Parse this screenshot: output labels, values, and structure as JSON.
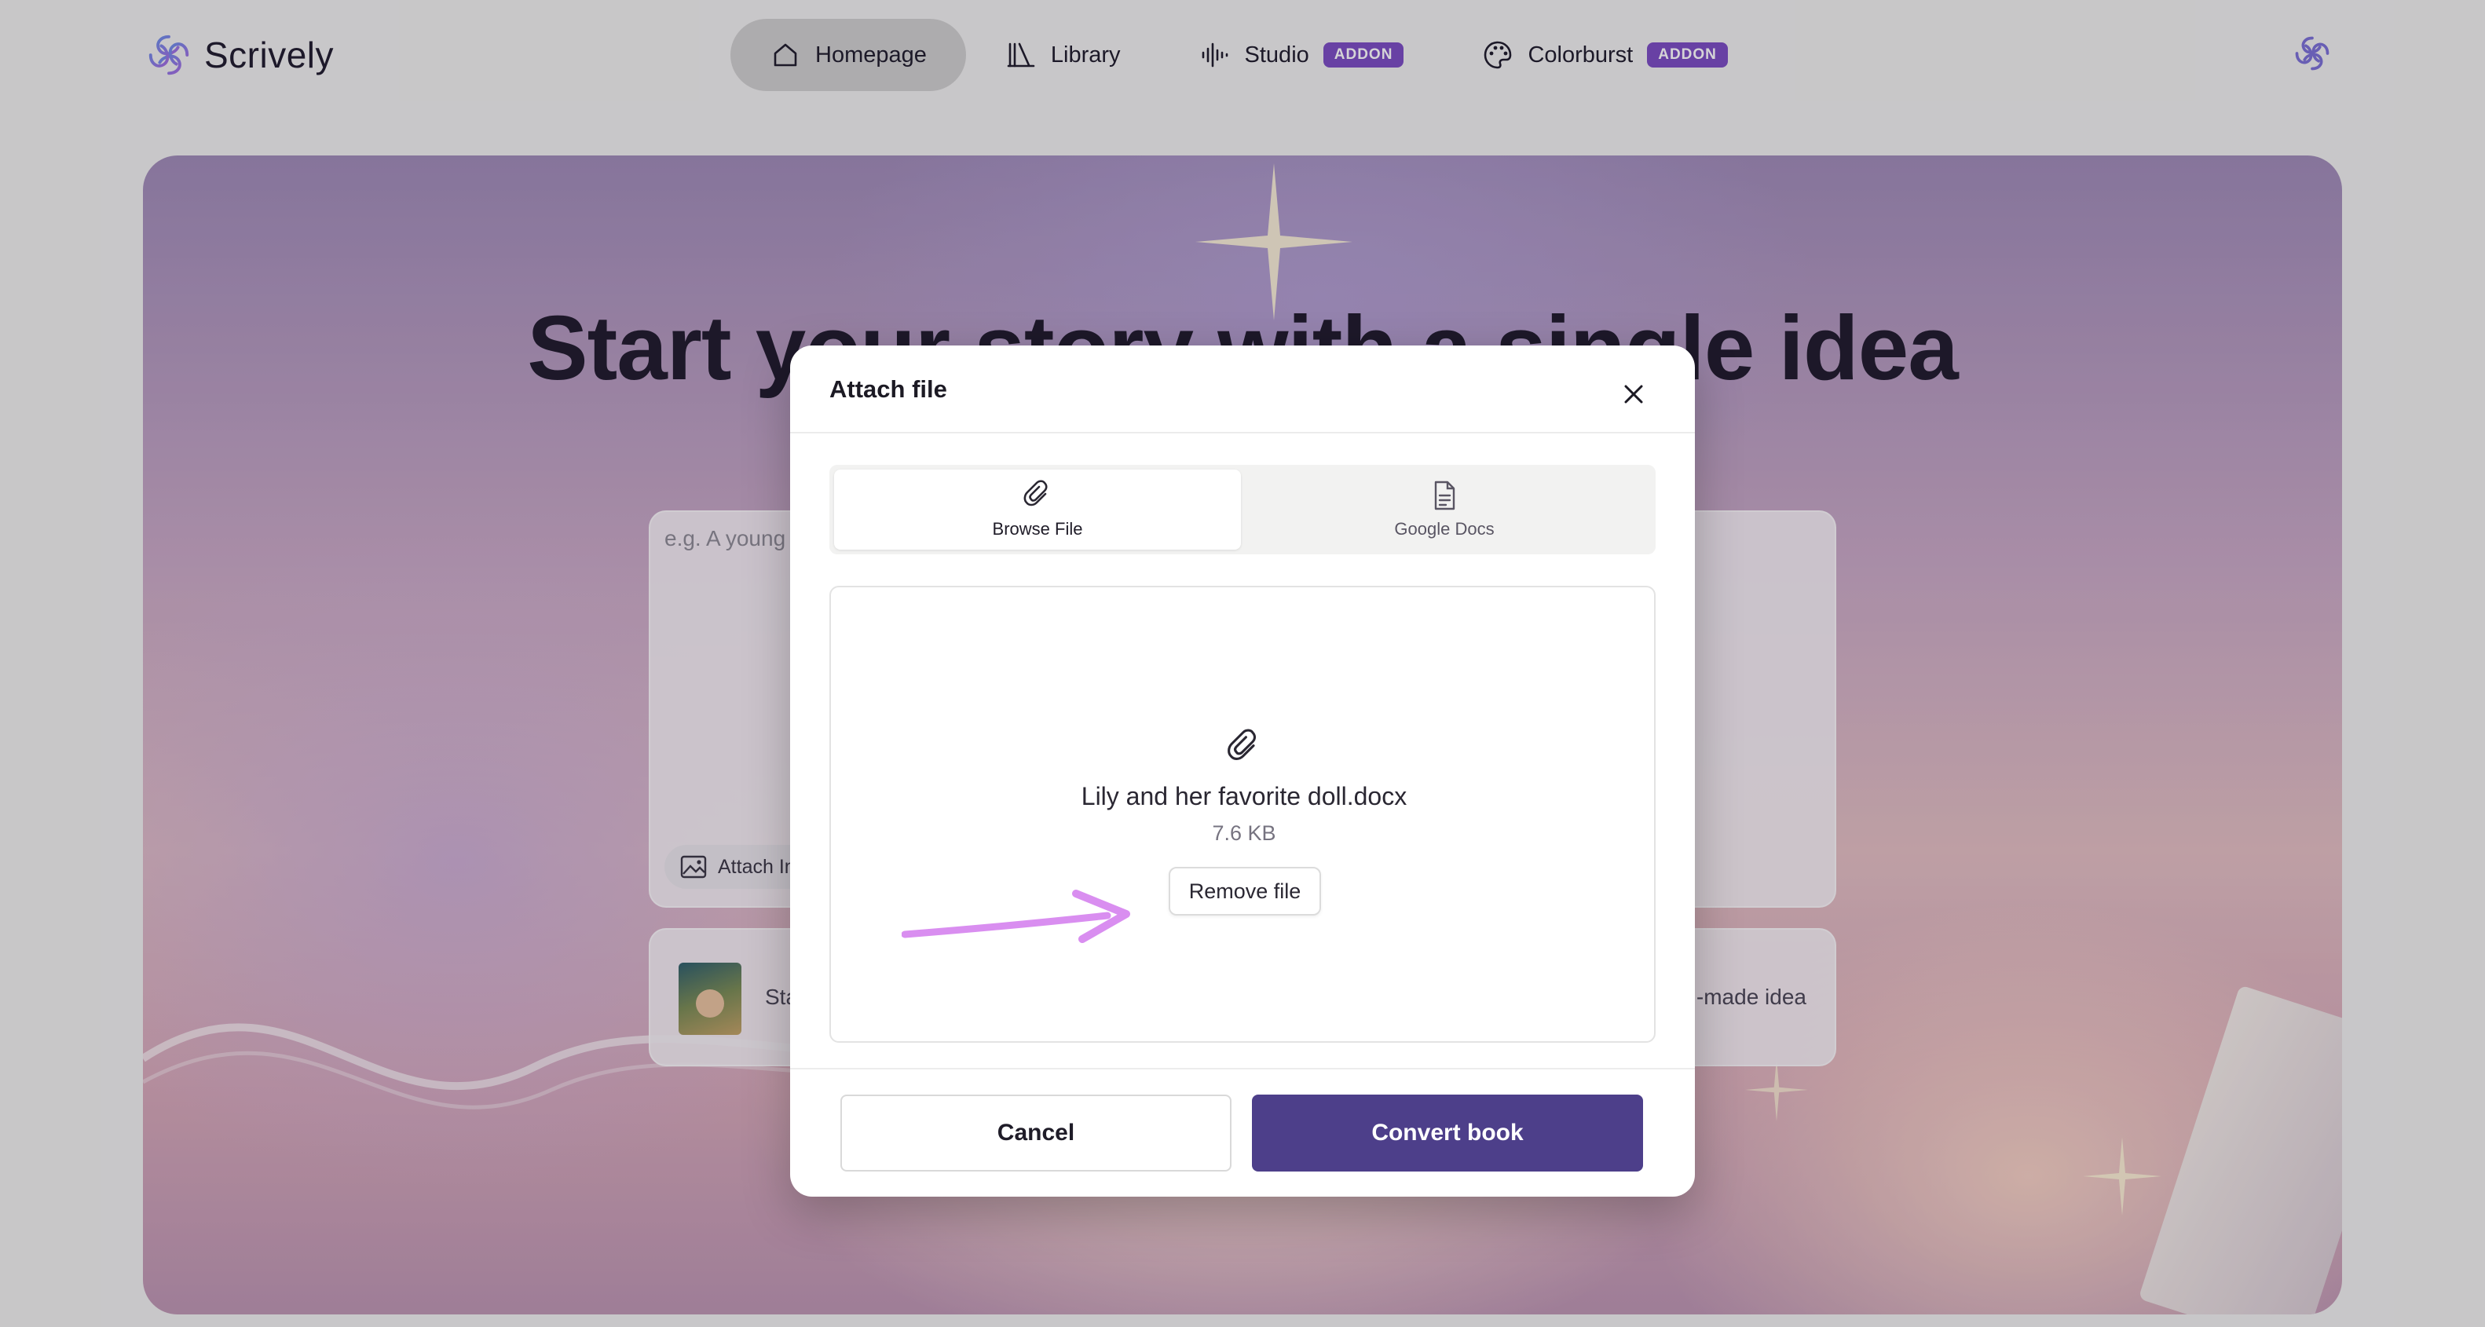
{
  "app": {
    "name": "Scrively"
  },
  "nav": {
    "items": [
      {
        "label": "Homepage",
        "icon": "home-icon",
        "active": true
      },
      {
        "label": "Library",
        "icon": "library-icon"
      },
      {
        "label": "Studio",
        "icon": "audio-waveform-icon",
        "badge": "ADDON"
      },
      {
        "label": "Colorburst",
        "icon": "palette-icon",
        "badge": "ADDON"
      }
    ]
  },
  "hero": {
    "title": "Start your story with a single idea",
    "prompt_placeholder": "e.g. A young",
    "attach_image_label": "Attach Im",
    "suggestion_left": "Sta",
    "suggestion_right": "-made idea"
  },
  "modal": {
    "title": "Attach file",
    "tabs": [
      {
        "label": "Browse File",
        "icon": "paperclip-icon",
        "active": true
      },
      {
        "label": "Google Docs",
        "icon": "document-icon",
        "active": false
      }
    ],
    "file": {
      "name": "Lily and her favorite doll.docx",
      "size": "7.6 KB"
    },
    "remove_label": "Remove file",
    "cancel_label": "Cancel",
    "convert_label": "Convert book"
  },
  "colors": {
    "accent": "#4d3f8a",
    "badge": "#7a4cc2",
    "annotation_arrow": "#d98ef0"
  }
}
